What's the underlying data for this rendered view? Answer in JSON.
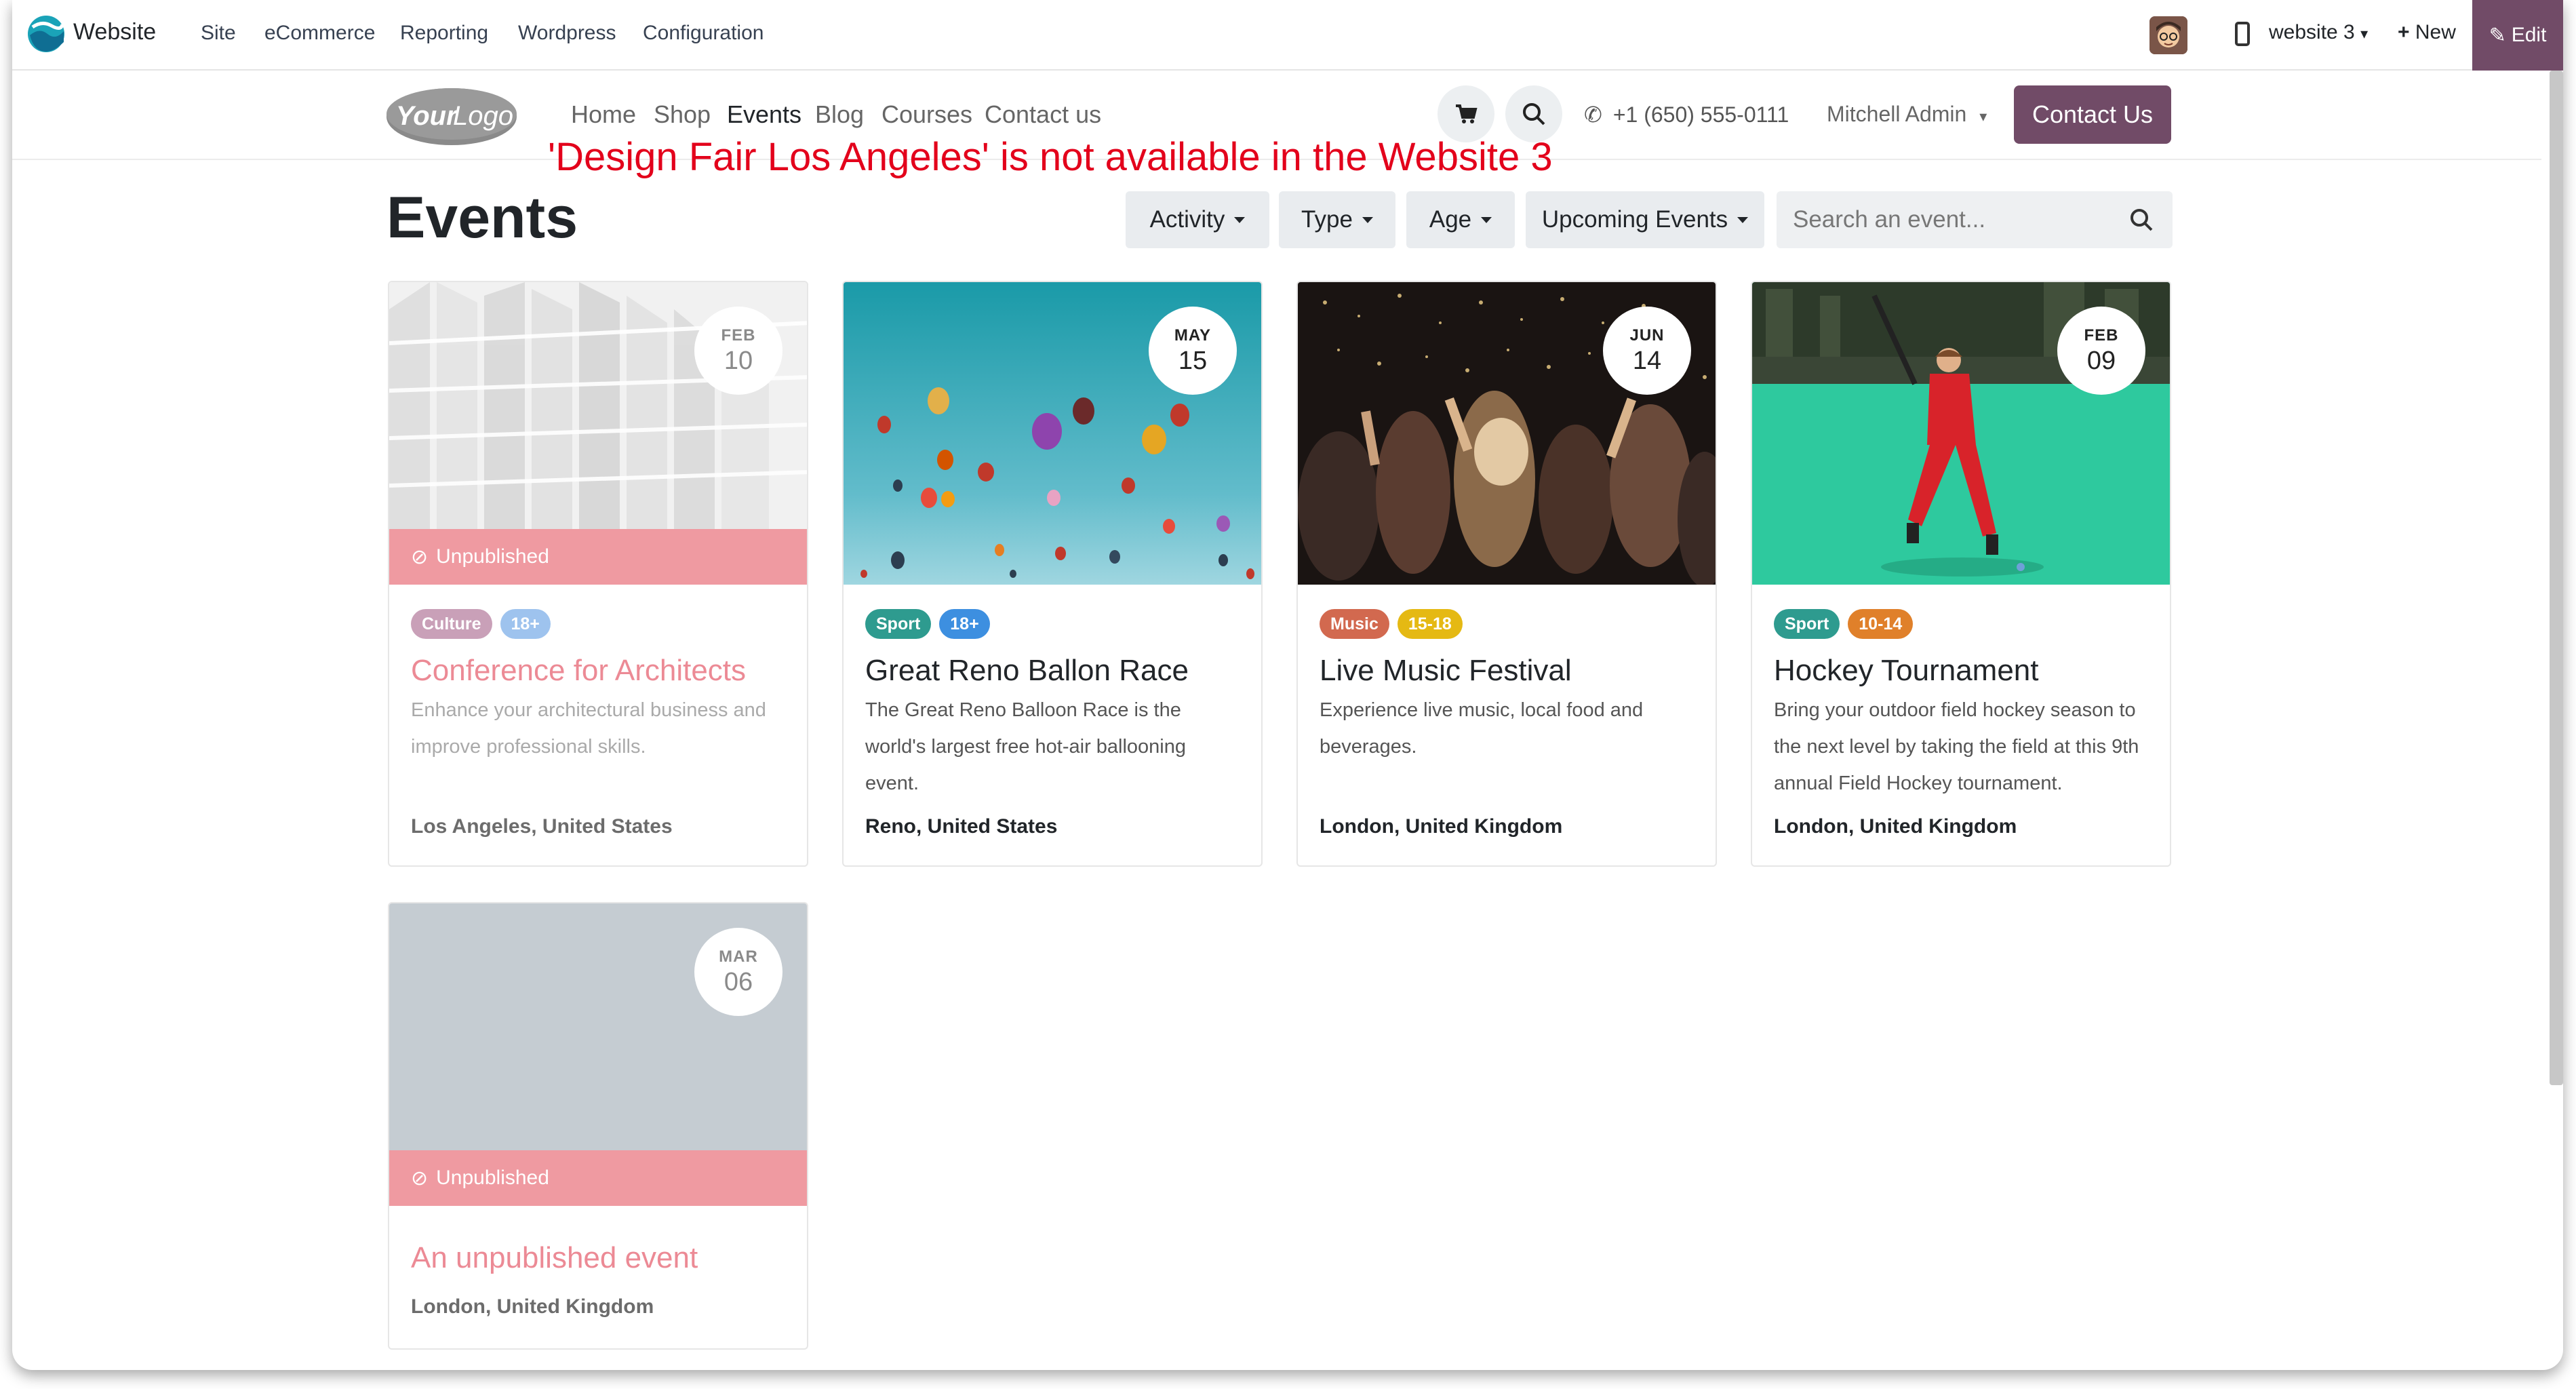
{
  "topbar": {
    "app_name": "Website",
    "menu": [
      "Site",
      "eCommerce",
      "Reporting",
      "Wordpress",
      "Configuration"
    ],
    "website_selector": "website 3",
    "new_label": "New",
    "edit_label": "Edit"
  },
  "header": {
    "logo_text": "YourLogo",
    "nav": [
      "Home",
      "Shop",
      "Events",
      "Blog",
      "Courses",
      "Contact us"
    ],
    "active_nav": "Events",
    "phone": "+1 (650) 555-0111",
    "user": "Mitchell Admin",
    "contact_button": "Contact Us"
  },
  "warning": "'Design Fair Los Angeles' is not available in the Website 3",
  "page": {
    "title": "Events",
    "filters": [
      "Activity",
      "Type",
      "Age",
      "Upcoming Events"
    ],
    "search_placeholder": "Search an event..."
  },
  "events": [
    {
      "month": "FEB",
      "day": "10",
      "status": "Unpublished",
      "tags": [
        {
          "label": "Culture",
          "color": "#c9a0b8"
        },
        {
          "label": "18+",
          "color": "#9ec3ee"
        }
      ],
      "title": "Conference for Architects",
      "description": "Enhance your architectural business and improve professional skills.",
      "location": "Los Angeles, United States",
      "published": false
    },
    {
      "month": "MAY",
      "day": "15",
      "tags": [
        {
          "label": "Sport",
          "color": "#2e9b8f"
        },
        {
          "label": "18+",
          "color": "#3d8fe0"
        }
      ],
      "title": "Great Reno Ballon Race",
      "description": "The Great Reno Balloon Race is the world's largest free hot-air ballooning event.",
      "location": "Reno, United States",
      "published": true
    },
    {
      "month": "JUN",
      "day": "14",
      "tags": [
        {
          "label": "Music",
          "color": "#d2694f"
        },
        {
          "label": "15-18",
          "color": "#e5b913"
        }
      ],
      "title": "Live Music Festival",
      "description": "Experience live music, local food and beverages.",
      "location": "London, United Kingdom",
      "published": true
    },
    {
      "month": "FEB",
      "day": "09",
      "tags": [
        {
          "label": "Sport",
          "color": "#2e9b8f"
        },
        {
          "label": "10-14",
          "color": "#e0802a"
        }
      ],
      "title": "Hockey Tournament",
      "description": "Bring your outdoor field hockey season to the next level by taking the field at this 9th annual Field Hockey tournament.",
      "location": "London, United Kingdom",
      "published": true
    },
    {
      "month": "MAR",
      "day": "06",
      "status": "Unpublished",
      "tags": [],
      "title": "An unpublished event",
      "description": "",
      "location": "London, United Kingdom",
      "published": false
    }
  ]
}
